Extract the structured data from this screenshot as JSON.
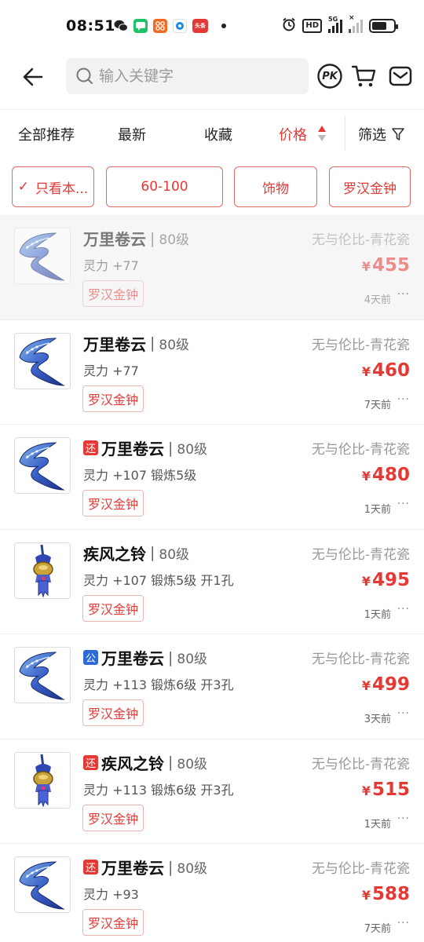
{
  "status_bar": {
    "time": "08:51",
    "app_badge_text": "头条",
    "hd_label": "HD",
    "net_label": "5G"
  },
  "header": {
    "search_placeholder": "输入关键字",
    "pk_label": "PK"
  },
  "sort_tabs": [
    {
      "label": "全部推荐"
    },
    {
      "label": "最新"
    },
    {
      "label": "收藏"
    },
    {
      "label": "价格",
      "active": true
    }
  ],
  "filter_label": "筛选",
  "chips": [
    {
      "label": "只看本...",
      "checked": true
    },
    {
      "label": "60-100"
    },
    {
      "label": "饰物"
    },
    {
      "label": "罗汉金钟"
    }
  ],
  "currency_symbol": "¥",
  "items": [
    {
      "name": "万里卷云",
      "level": "80级",
      "attrs": "灵力 +77",
      "badge": "罗汉金钟",
      "server": "无与伦比-青花瓷",
      "price": "455",
      "time": "4天前",
      "tag": "",
      "icon": "ribbon-icon",
      "dimmed": true
    },
    {
      "name": "万里卷云",
      "level": "80级",
      "attrs": "灵力 +77",
      "badge": "罗汉金钟",
      "server": "无与伦比-青花瓷",
      "price": "460",
      "time": "7天前",
      "tag": "",
      "icon": "ribbon-icon"
    },
    {
      "name": "万里卷云",
      "level": "80级",
      "attrs": "灵力 +107 锻炼5级",
      "badge": "罗汉金钟",
      "server": "无与伦比-青花瓷",
      "price": "480",
      "time": "1天前",
      "tag": "还",
      "tag_color": "#e53935",
      "icon": "ribbon-icon"
    },
    {
      "name": "疾风之铃",
      "level": "80级",
      "attrs": "灵力 +107 锻炼5级 开1孔",
      "badge": "罗汉金钟",
      "server": "无与伦比-青花瓷",
      "price": "495",
      "time": "1天前",
      "tag": "",
      "icon": "bell-icon"
    },
    {
      "name": "万里卷云",
      "level": "80级",
      "attrs": "灵力 +113 锻炼6级 开3孔",
      "badge": "罗汉金钟",
      "server": "无与伦比-青花瓷",
      "price": "499",
      "time": "3天前",
      "tag": "公",
      "tag_color": "#2e6bd9",
      "icon": "ribbon-icon"
    },
    {
      "name": "疾风之铃",
      "level": "80级",
      "attrs": "灵力 +113 锻炼6级 开3孔",
      "badge": "罗汉金钟",
      "server": "无与伦比-青花瓷",
      "price": "515",
      "time": "1天前",
      "tag": "还",
      "tag_color": "#e53935",
      "icon": "bell-icon"
    },
    {
      "name": "万里卷云",
      "level": "80级",
      "attrs": "灵力 +93",
      "badge": "罗汉金钟",
      "server": "无与伦比-青花瓷",
      "price": "588",
      "time": "7天前",
      "tag": "还",
      "tag_color": "#e53935",
      "icon": "ribbon-icon"
    }
  ],
  "colors": {
    "accent": "#e53935",
    "tag_blue": "#2e6bd9"
  }
}
